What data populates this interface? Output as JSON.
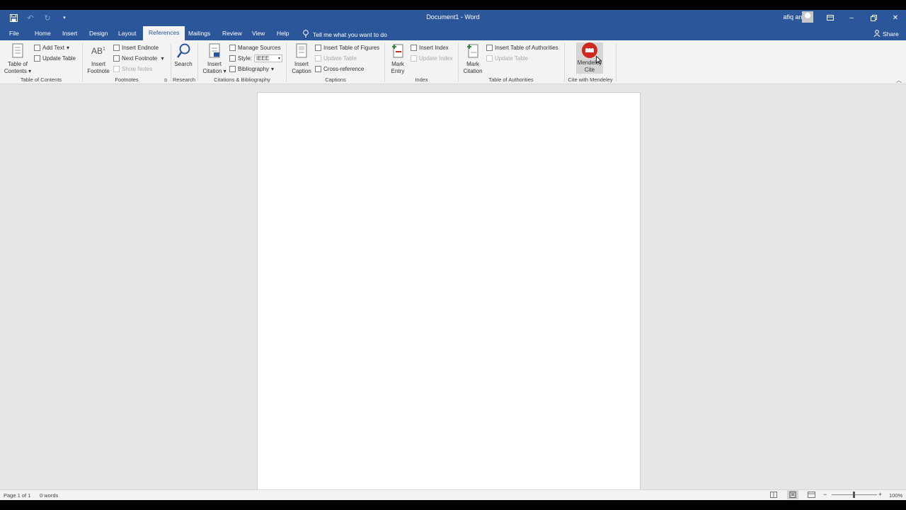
{
  "window": {
    "title": "Document1  -  Word",
    "user": "afiq amirin"
  },
  "tabs": [
    "File",
    "Home",
    "Insert",
    "Design",
    "Layout",
    "References",
    "Mailings",
    "Review",
    "View",
    "Help"
  ],
  "active_tab": "References",
  "tell_me": "Tell me what you want to do",
  "share": "Share",
  "ribbon": {
    "toc": {
      "table_of_contents_1": "Table of",
      "table_of_contents_2": "Contents",
      "add_text": "Add Text",
      "update_table": "Update Table",
      "group": "Table of Contents"
    },
    "footnotes": {
      "insert_footnote_1": "Insert",
      "insert_footnote_2": "Footnote",
      "insert_endnote": "Insert Endnote",
      "next_footnote": "Next Footnote",
      "show_notes": "Show Notes",
      "group": "Footnotes"
    },
    "research": {
      "search": "Search",
      "group": "Research"
    },
    "citations": {
      "insert_citation_1": "Insert",
      "insert_citation_2": "Citation",
      "manage_sources": "Manage Sources",
      "style_label": "Style:",
      "style_value": "IEEE",
      "bibliography": "Bibliography",
      "group": "Citations & Bibliography"
    },
    "captions": {
      "insert_caption_1": "Insert",
      "insert_caption_2": "Caption",
      "insert_table_of_figures": "Insert Table of Figures",
      "update_table": "Update Table",
      "cross_reference": "Cross-reference",
      "group": "Captions"
    },
    "index": {
      "mark_entry_1": "Mark",
      "mark_entry_2": "Entry",
      "insert_index": "Insert Index",
      "update_index": "Update Index",
      "group": "Index"
    },
    "authorities": {
      "mark_citation_1": "Mark",
      "mark_citation_2": "Citation",
      "insert_table_of_authorities": "Insert Table of Authorities",
      "update_table": "Update Table",
      "group": "Table of Authorities"
    },
    "mendeley": {
      "cite_1": "Mendeley",
      "cite_2": "Cite",
      "group": "Cite with Mendeley"
    }
  },
  "status": {
    "page": "Page 1 of 1",
    "words": "0 words",
    "zoom": "100%"
  },
  "colors": {
    "titlebar": "#2b579a",
    "mendeley": "#d0281c"
  }
}
